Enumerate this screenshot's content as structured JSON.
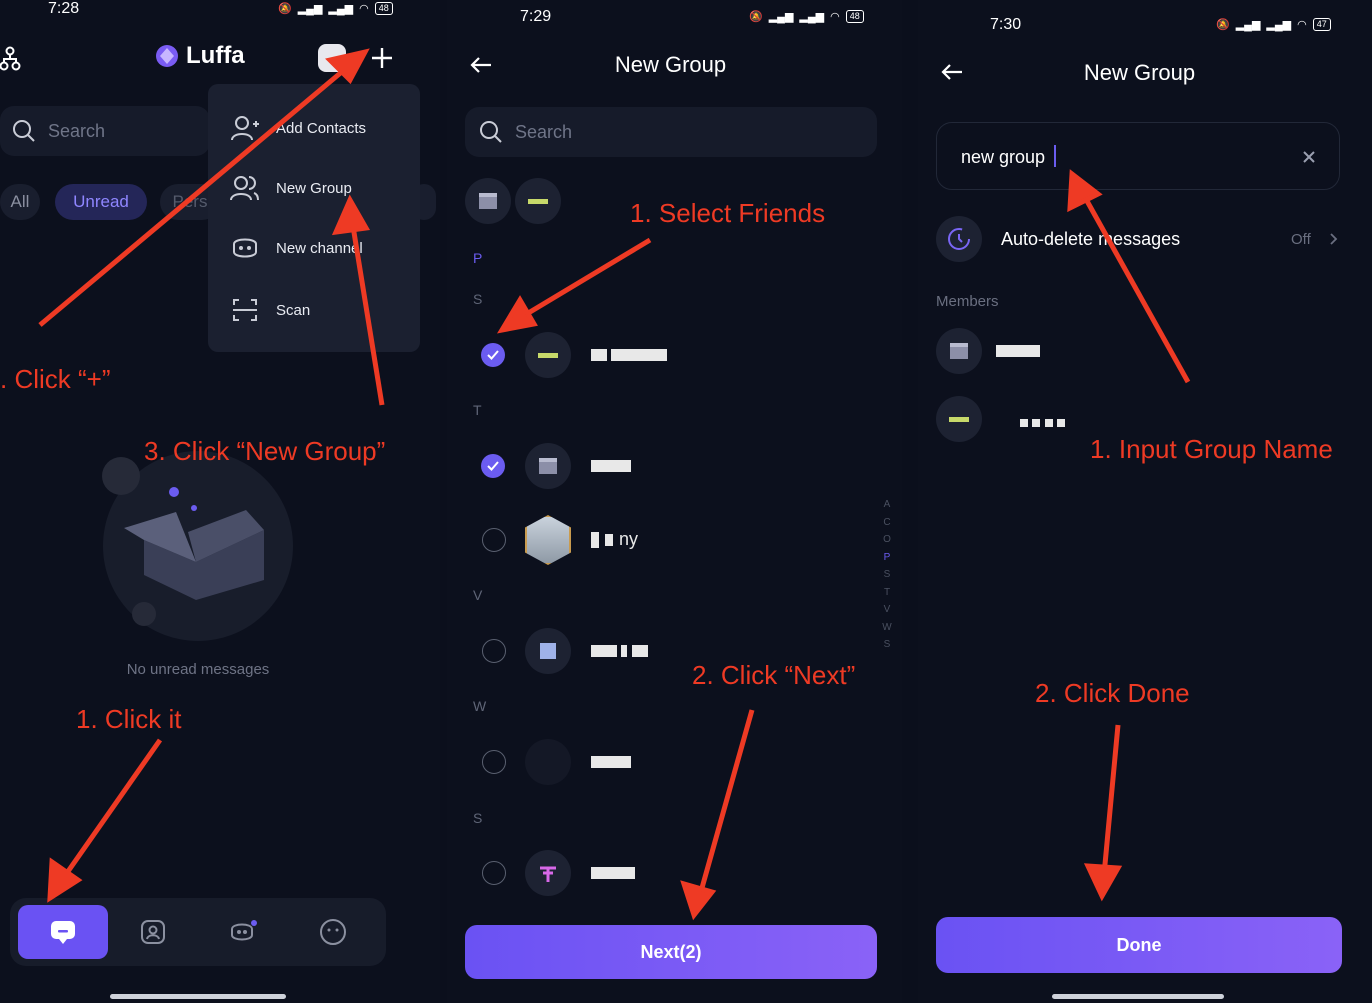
{
  "screen1": {
    "time": "7:28",
    "battery": "48",
    "app_name": "Luffa",
    "search": {
      "placeholder": "Search"
    },
    "filters": {
      "all": "All",
      "unread": "Unread",
      "partial": "Pers"
    },
    "menu": {
      "add_contacts": "Add Contacts",
      "new_group": "New Group",
      "new_channel": "New channel",
      "scan": "Scan"
    },
    "empty_text": "No unread messages",
    "annotations": {
      "step1": "1. Click it",
      "step2": ". Click “+”",
      "step3": "3. Click “New Group”"
    }
  },
  "screen2": {
    "time": "7:29",
    "battery": "48",
    "title": "New Group",
    "search": {
      "placeholder": "Search"
    },
    "sections": [
      "P",
      "S",
      "T",
      "V",
      "W",
      "S"
    ],
    "contacts": [
      {
        "partial_name": "",
        "checked": true
      },
      {
        "partial_name": "",
        "checked": true
      },
      {
        "partial_name": "ny",
        "checked": false
      },
      {
        "partial_name": "",
        "checked": false
      },
      {
        "partial_name": "",
        "checked": false
      },
      {
        "partial_name": "",
        "checked": false
      }
    ],
    "index_letters": [
      "A",
      "C",
      "O",
      "P",
      "S",
      "T",
      "V",
      "W",
      "S"
    ],
    "next_button": "Next(2)",
    "annotations": {
      "step1": "1. Select Friends",
      "step2": "2. Click “Next”"
    }
  },
  "screen3": {
    "time": "7:30",
    "battery": "47",
    "title": "New Group",
    "group_name_value": "new group",
    "auto_delete_label": "Auto-delete messages",
    "auto_delete_value": "Off",
    "members_label": "Members",
    "done_button": "Done",
    "annotations": {
      "step1": "1. Input Group Name",
      "step2": "2. Click Done"
    }
  },
  "colors": {
    "accent": "#6b5cf0",
    "annotation": "#ee3a24",
    "background": "#0c101d"
  }
}
